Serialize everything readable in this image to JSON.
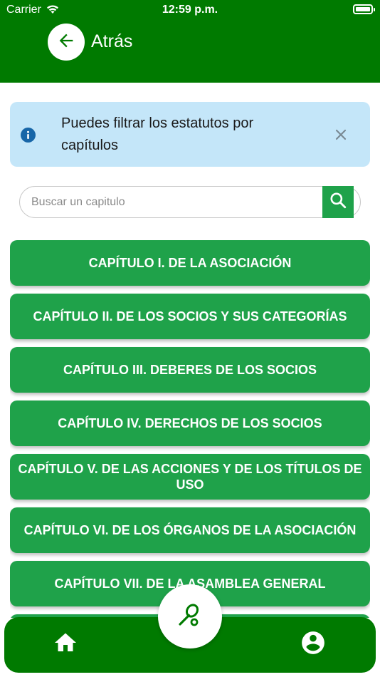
{
  "status_bar": {
    "carrier": "Carrier",
    "time": "12:59 p.m."
  },
  "header": {
    "back_label": "Atrás"
  },
  "info_banner": {
    "text": "Puedes filtrar los estatutos por capítulos"
  },
  "search": {
    "placeholder": "Buscar un capitulo",
    "value": ""
  },
  "chapters": [
    {
      "label": "CAPÍTULO I. DE LA ASOCIACIÓN"
    },
    {
      "label": "CAPÍTULO II. DE LOS SOCIOS Y SUS CATEGORÍAS"
    },
    {
      "label": "CAPÍTULO III. DEBERES DE LOS SOCIOS"
    },
    {
      "label": "CAPÍTULO IV. DERECHOS DE LOS SOCIOS"
    },
    {
      "label": "CAPÍTULO V. DE LAS ACCIONES Y DE LOS TÍTULOS DE USO"
    },
    {
      "label": "CAPÍTULO VI. DE LOS ÓRGANOS DE LA ASOCIACIÓN"
    },
    {
      "label": "CAPÍTULO VII. DE LA ASAMBLEA GENERAL"
    },
    {
      "label": ""
    }
  ],
  "bottom_nav": {
    "home_icon": "home-icon",
    "center_icon": "racket-icon",
    "profile_icon": "account-circle-icon"
  },
  "colors": {
    "header_green": "#007a00",
    "button_green": "#1fa24a",
    "info_bg": "#c4e6f9",
    "info_icon": "#1766a8"
  }
}
